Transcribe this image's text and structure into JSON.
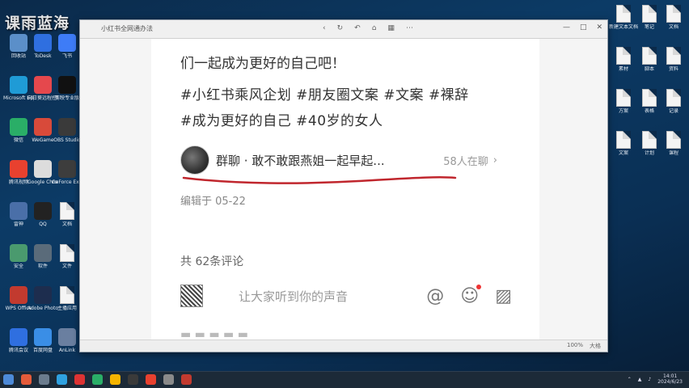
{
  "watermark": "课雨蓝海",
  "window": {
    "title": "小红书全网通办法",
    "controls": [
      "—",
      "□",
      "✕"
    ]
  },
  "post": {
    "line1": "们一起成为更好的自己吧！",
    "tags_line1": "#小红书乘风企划 #朋友圈文案 #文案 #裸辞",
    "tags_line2": "#成为更好的自己 #40岁的女人",
    "group_name": "群聊 · 敢不敢跟燕姐一起早起...",
    "group_count": "58人在聊",
    "chevron": "›",
    "edited": "编辑于 05-22",
    "comments": "共 62条评论",
    "comment_placeholder": "让大家听到你的声音",
    "icons": {
      "at": "@",
      "emoji": "☺",
      "image": "▨"
    }
  },
  "statusbar": {
    "items": [
      "100%",
      "大格"
    ]
  },
  "taskbar": {
    "time": "14:01",
    "date": "2024/6/23"
  },
  "desktop_left": [
    {
      "label": "回收站",
      "color": "#5b8fc9"
    },
    {
      "label": "ToDesk",
      "color": "#2f6fe0"
    },
    {
      "label": "飞书",
      "color": "#3e7cf7"
    },
    {
      "label": "Microsoft Edge",
      "color": "#1f9bd6"
    },
    {
      "label": "向日葵远程控制",
      "color": "#e5484d"
    },
    {
      "label": "剪映专业版",
      "color": "#111111"
    },
    {
      "label": "微信",
      "color": "#2aae67"
    },
    {
      "label": "WeGame",
      "color": "#d84a3a"
    },
    {
      "label": "OBS Studio",
      "color": "#3a3a3a"
    },
    {
      "label": "腾讯视频",
      "color": "#e8412f"
    },
    {
      "label": "Google Chrome",
      "color": "#dcdcdc"
    },
    {
      "label": "GeForce Experience",
      "color": "#3d3d3d"
    },
    {
      "label": "雷神",
      "color": "#4a6fa8"
    },
    {
      "label": "QQ",
      "color": "#222222"
    },
    {
      "label": "文档",
      "color": "#f2f2f2"
    },
    {
      "label": "安全",
      "color": "#4a9a6e"
    },
    {
      "label": "软件",
      "color": "#5a6b7a"
    },
    {
      "label": "文件",
      "color": "#f2f2f2"
    },
    {
      "label": "WPS Office",
      "color": "#c23a2f"
    },
    {
      "label": "Adobe Photoshop",
      "color": "#1d2d4e"
    },
    {
      "label": "主播应用",
      "color": "#f2f2f2"
    },
    {
      "label": "腾讯会议",
      "color": "#2f6fe0"
    },
    {
      "label": "百度网盘",
      "color": "#3a8ee6"
    },
    {
      "label": "AnLink",
      "color": "#6a7fa0"
    }
  ],
  "desktop_right": [
    {
      "label": "新建文本文档",
      "color": "#f2f2f2"
    },
    {
      "label": "笔记",
      "color": "#f2f2f2"
    },
    {
      "label": "文档",
      "color": "#f2f2f2"
    },
    {
      "label": "素材",
      "color": "#f2f2f2"
    },
    {
      "label": "脚本",
      "color": "#f2f2f2"
    },
    {
      "label": "资料",
      "color": "#f2f2f2"
    },
    {
      "label": "方案",
      "color": "#f2f2f2"
    },
    {
      "label": "表格",
      "color": "#f2f2f2"
    },
    {
      "label": "记录",
      "color": "#f2f2f2"
    },
    {
      "label": "文案",
      "color": "#f2f2f2"
    },
    {
      "label": "计划",
      "color": "#f2f2f2"
    },
    {
      "label": "课程",
      "color": "#f2f2f2"
    }
  ]
}
